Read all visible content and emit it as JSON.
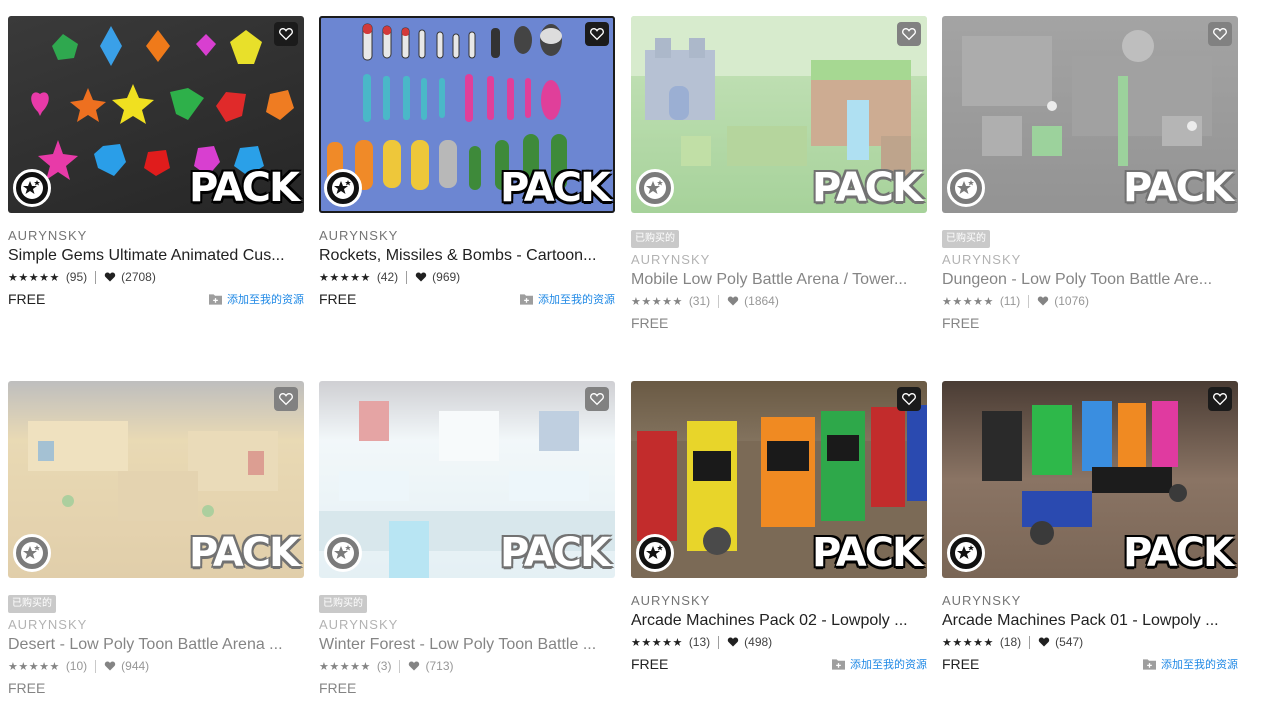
{
  "fav_label": "favorite",
  "pack_label": "PACK",
  "owned_tag": "已购买的",
  "add_to_assets": "添加至我的资源",
  "cards": [
    {
      "publisher": "AURYNSKY",
      "title": "Simple Gems Ultimate Animated Cus...",
      "stars": "★★★★★",
      "rating": "(95)",
      "likes": "(2708)",
      "price": "FREE",
      "owned": false
    },
    {
      "publisher": "AURYNSKY",
      "title": "Rockets, Missiles & Bombs - Cartoon...",
      "stars": "★★★★★",
      "rating": "(42)",
      "likes": "(969)",
      "price": "FREE",
      "owned": false
    },
    {
      "publisher": "AURYNSKY",
      "title": "Mobile Low Poly Battle Arena / Tower...",
      "stars": "★★★★★",
      "rating": "(31)",
      "likes": "(1864)",
      "price": "FREE",
      "owned": true
    },
    {
      "publisher": "AURYNSKY",
      "title": "Dungeon - Low Poly Toon Battle Are...",
      "stars": "★★★★★",
      "rating": "(11)",
      "likes": "(1076)",
      "price": "FREE",
      "owned": true
    },
    {
      "publisher": "AURYNSKY",
      "title": "Desert - Low Poly Toon Battle Arena ...",
      "stars": "★★★★★",
      "rating": "(10)",
      "likes": "(944)",
      "price": "FREE",
      "owned": true
    },
    {
      "publisher": "AURYNSKY",
      "title": "Winter Forest - Low Poly Toon Battle ...",
      "stars": "★★★★★",
      "rating": "(3)",
      "likes": "(713)",
      "price": "FREE",
      "owned": true
    },
    {
      "publisher": "AURYNSKY",
      "title": "Arcade Machines Pack 02 - Lowpoly ...",
      "stars": "★★★★★",
      "rating": "(13)",
      "likes": "(498)",
      "price": "FREE",
      "owned": false
    },
    {
      "publisher": "AURYNSKY",
      "title": "Arcade Machines Pack 01 - Lowpoly ...",
      "stars": "★★★★★",
      "rating": "(18)",
      "likes": "(547)",
      "price": "FREE",
      "owned": false
    }
  ]
}
